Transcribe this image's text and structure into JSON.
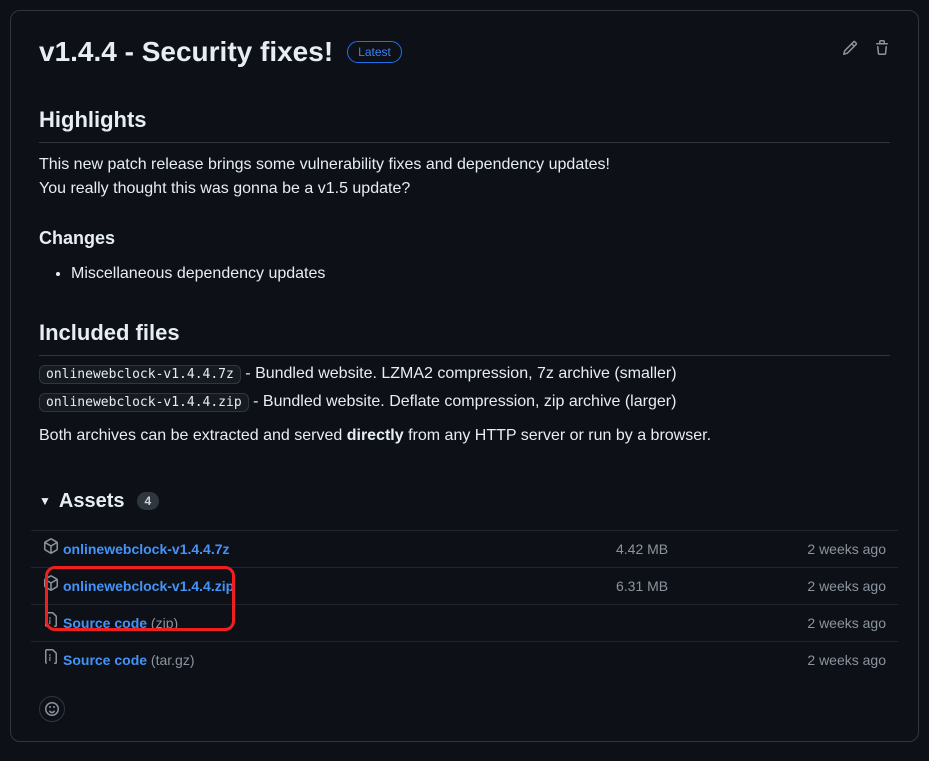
{
  "release": {
    "title": "v1.4.4 - Security fixes!",
    "latest_badge": "Latest"
  },
  "body": {
    "highlights_heading": "Highlights",
    "highlights_p1": "This new patch release brings some vulnerability fixes and dependency updates!",
    "highlights_p2": "You really thought this was gonna be a v1.5 update?",
    "changes_heading": "Changes",
    "changes_item": "Miscellaneous dependency updates",
    "files_heading": "Included files",
    "file1_code": "onlinewebclock-v1.4.4.7z",
    "file1_desc": " - Bundled website. LZMA2 compression, 7z archive (smaller)",
    "file2_code": "onlinewebclock-v1.4.4.zip",
    "file2_desc": " - Bundled website. Deflate compression, zip archive (larger)",
    "served_prefix": "Both archives can be extracted and served ",
    "served_bold": "directly",
    "served_suffix": " from any HTTP server or run by a browser."
  },
  "assets": {
    "label": "Assets",
    "count": "4",
    "items": [
      {
        "name": "onlinewebclock-v1.4.4.7z",
        "size": "4.42 MB",
        "date": "2 weeks ago",
        "icon": "package"
      },
      {
        "name": "onlinewebclock-v1.4.4.zip",
        "size": "6.31 MB",
        "date": "2 weeks ago",
        "icon": "package"
      },
      {
        "name": "Source code",
        "paren": "(zip)",
        "size": "",
        "date": "2 weeks ago",
        "icon": "zip"
      },
      {
        "name": "Source code",
        "paren": "(tar.gz)",
        "size": "",
        "date": "2 weeks ago",
        "icon": "zip"
      }
    ]
  }
}
